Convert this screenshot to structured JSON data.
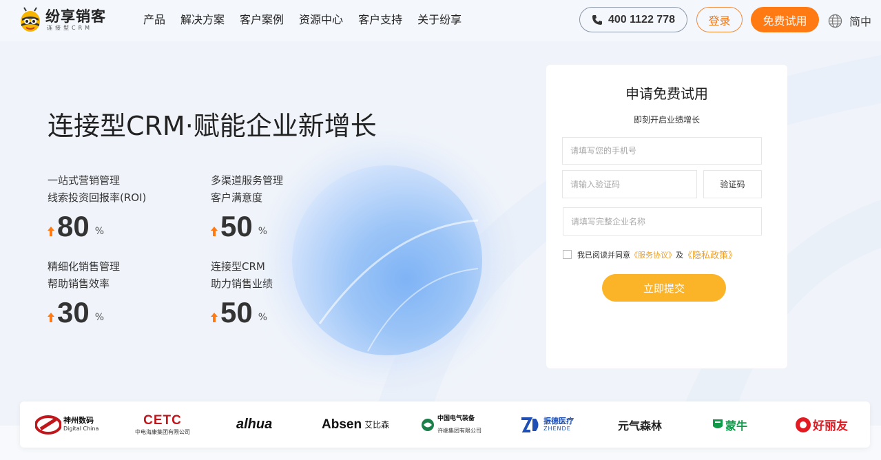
{
  "header": {
    "logo_name": "纷享销客",
    "logo_sub": "连接型CRM",
    "nav": [
      "产品",
      "解决方案",
      "客户案例",
      "资源中心",
      "客户支持",
      "关于纷享"
    ],
    "phone": "400 1122 778",
    "login_label": "登录",
    "trial_label": "免费试用",
    "language": "简中"
  },
  "hero": {
    "title": "连接型CRM·赋能企业新增长",
    "stats": [
      {
        "line1": "一站式营销管理",
        "line2": "线索投资回报率(ROI)",
        "value": "80",
        "unit": "%"
      },
      {
        "line1": "多渠道服务管理",
        "line2": "客户满意度",
        "value": "50",
        "unit": "%"
      },
      {
        "line1": "精细化销售管理",
        "line2": "帮助销售效率",
        "value": "30",
        "unit": "%"
      },
      {
        "line1": "连接型CRM",
        "line2": "助力销售业绩",
        "value": "50",
        "unit": "%"
      }
    ]
  },
  "form": {
    "title": "申请免费试用",
    "subtitle": "即刻开启业绩增长",
    "phone_placeholder": "请填写您的手机号",
    "code_placeholder": "请输入验证码",
    "code_button": "验证码",
    "company_placeholder": "请填写完整企业名称",
    "agree_prefix": "我已阅读并同意",
    "service_link": "《服务协议》",
    "agree_and": "及",
    "privacy_link": "《隐私政策》",
    "submit_label": "立即提交"
  },
  "logos": {
    "digital_china_cn": "神州数码",
    "digital_china_en": "Digital China",
    "cetc": "CETC",
    "cetc_sub": "中电海康集团有限公司",
    "dahua": "alhua",
    "absen": "Absen",
    "absen_cn": "艾比森",
    "cee_cn": "中国电气装备",
    "cee_sub": "许继集团有限公司",
    "zhende_cn": "振德医疗",
    "zhende_en": "ZHENDE",
    "yuanqi": "元气森林",
    "mengniu": "蒙牛",
    "haoliyou": "好丽友"
  },
  "colors": {
    "accent_orange": "#ff7a12",
    "submit_yellow": "#fbb327",
    "link_orange": "#f0a020"
  }
}
